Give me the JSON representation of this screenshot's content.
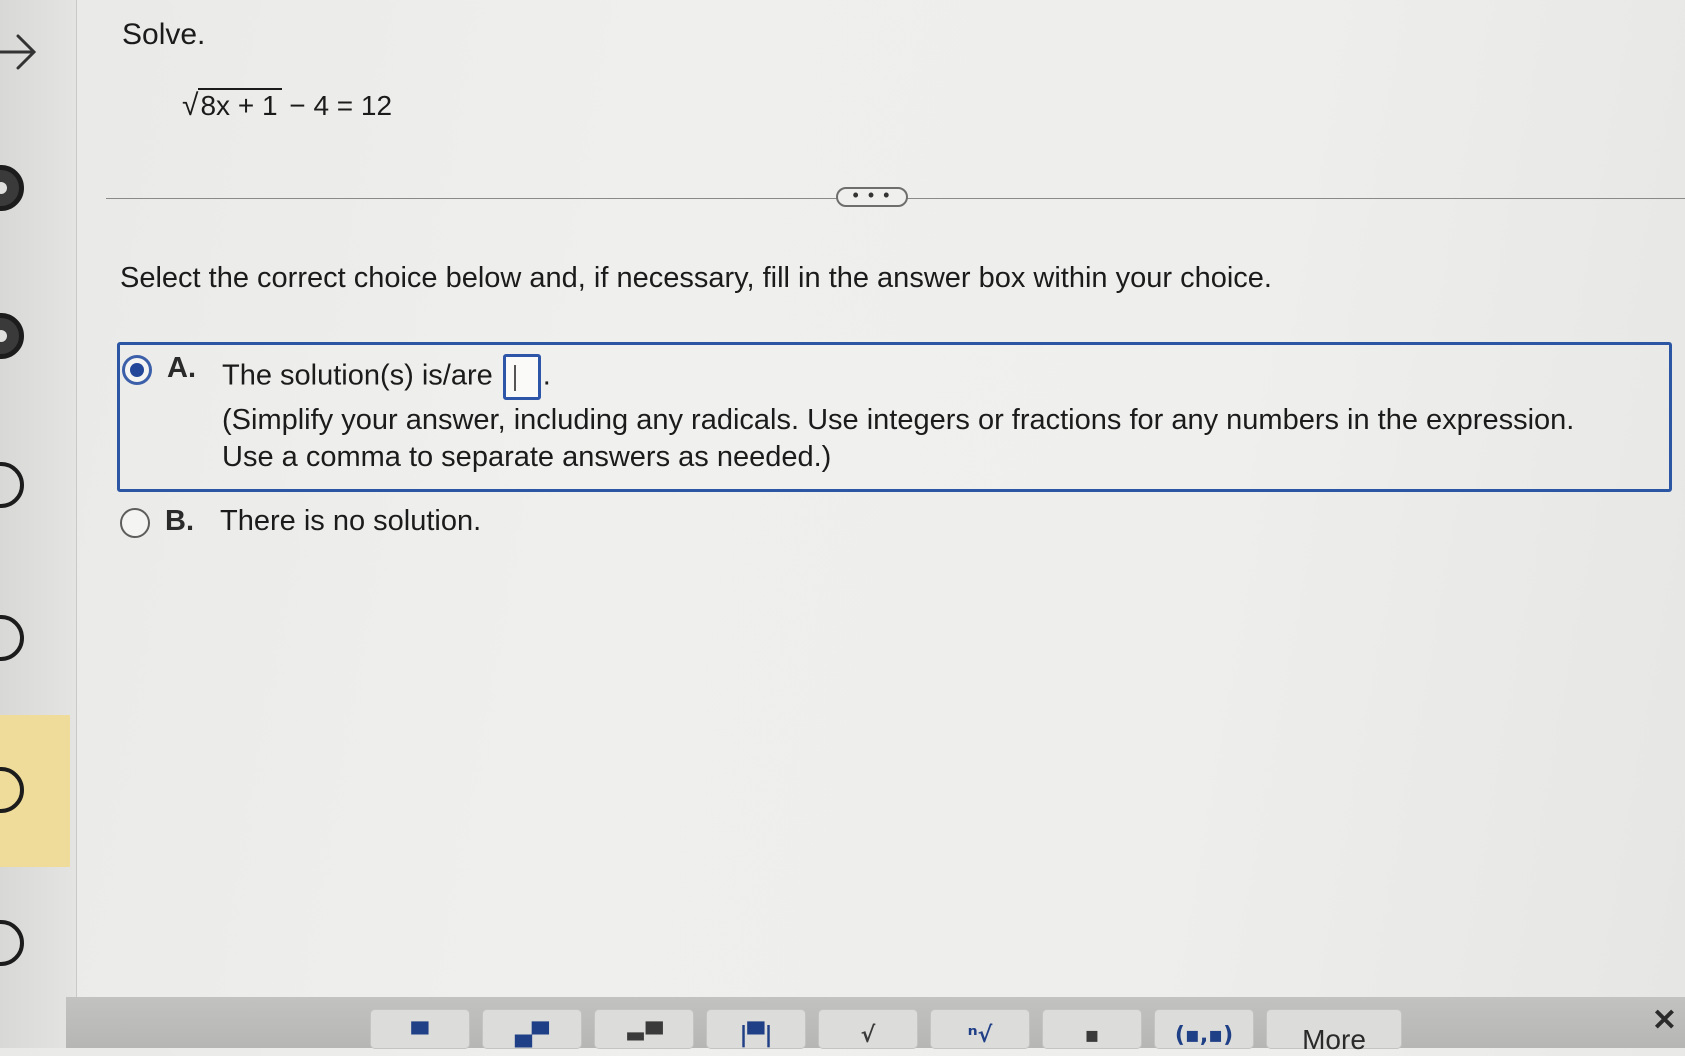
{
  "question": {
    "title": "Solve.",
    "equation": {
      "radicand": "8x + 1",
      "rest": " − 4 = 12"
    },
    "more_label": "• • •",
    "instruction": "Select the correct choice below and, if necessary, fill in the answer box within your choice."
  },
  "choices": [
    {
      "letter": "A.",
      "text_before": "The solution(s) is/are",
      "text_after": ".",
      "hint_line1": "(Simplify your answer, including any radicals. Use integers or fractions for any numbers in the expression.",
      "hint_line2": "Use a comma to separate answers as needed.)",
      "answer_value": "",
      "selected": true
    },
    {
      "letter": "B.",
      "text": "There is no solution.",
      "selected": false
    }
  ],
  "toolbar": {
    "buttons": [
      "fraction-icon",
      "mixed-number-icon",
      "exponent-icon",
      "absolute-value-icon",
      "square-root-icon",
      "nth-root-icon",
      "decimal-icon",
      "ordered-pair-icon"
    ],
    "more_label": "More"
  },
  "colors": {
    "accent": "#2a56a4",
    "highlight": "#efdc9a"
  }
}
